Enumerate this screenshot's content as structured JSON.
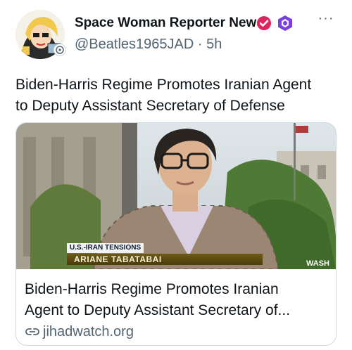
{
  "post": {
    "display_name": "Space Woman Reporter News",
    "handle": "@Beatles1965JAD",
    "separator": "·",
    "time": "5h",
    "more_menu": "···",
    "text_line1": "Biden-Harris Regime Promotes Iranian Agent",
    "text_line2": "to Deputy Assistant Secretary of Defense",
    "avatar_icon": "cartoon-woman-avatar",
    "verified_icon": "verified-check-icon",
    "extra_badge_icon": "purple-hexagon-badge-icon"
  },
  "card": {
    "image_chyron_tag": "U.S.-IRAN TENSIONS",
    "image_chyron_name": "ARIANE TABATABAI",
    "image_chyron_corner": "WASH",
    "title_line1": "Biden-Harris Regime Promotes Iranian",
    "title_line2": "Agent to Deputy Assistant Secretary of...",
    "domain": "jihadwatch.org",
    "domain_icon": "link-icon"
  },
  "colors": {
    "text_primary": "#0f1419",
    "text_secondary": "#536471",
    "verified_red": "#e0245e",
    "badge_purple": "#7b3fe4",
    "border": "#cfd9de"
  }
}
